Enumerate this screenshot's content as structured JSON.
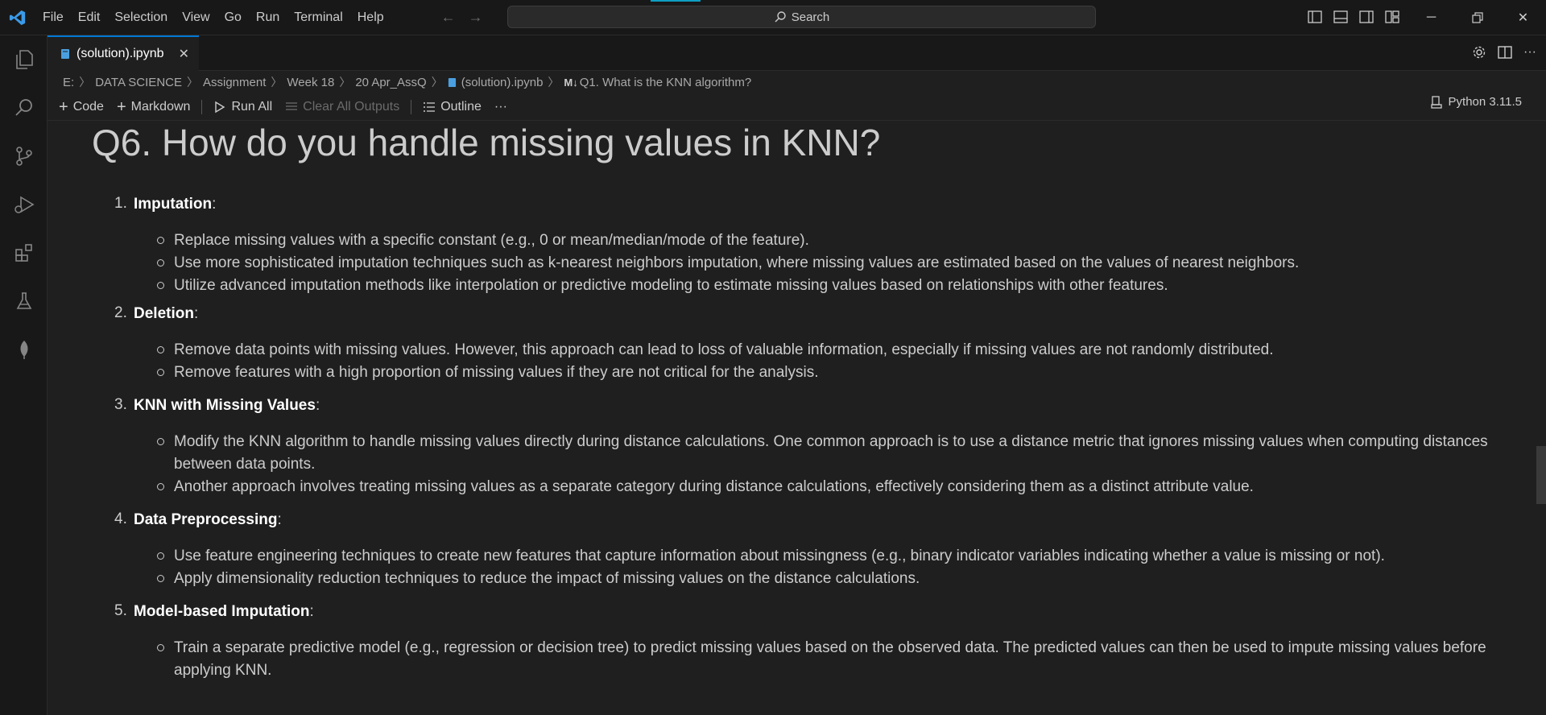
{
  "menu": [
    "File",
    "Edit",
    "Selection",
    "View",
    "Go",
    "Run",
    "Terminal",
    "Help"
  ],
  "search": {
    "label": "Search"
  },
  "tab": {
    "filename": "(solution).ipynb"
  },
  "breadcrumb": {
    "items": [
      "E:",
      "DATA SCIENCE",
      "Assignment",
      "Week 18",
      "20 Apr_AssQ",
      "(solution).ipynb"
    ],
    "last": "Q1. What is the KNN algorithm?",
    "md_badge": "M↓"
  },
  "toolbar": {
    "code": "Code",
    "markdown": "Markdown",
    "run_all": "Run All",
    "clear_all": "Clear All Outputs",
    "outline": "Outline",
    "more": "···",
    "kernel": "Python 3.11.5"
  },
  "notebook": {
    "heading": "Q6. How do you handle missing values in KNN?",
    "sections": [
      {
        "num": "1.",
        "title": "Imputation",
        "bullets": [
          "Replace missing values with a specific constant (e.g., 0 or mean/median/mode of the feature).",
          "Use more sophisticated imputation techniques such as k-nearest neighbors imputation, where missing values are estimated based on the values of nearest neighbors.",
          "Utilize advanced imputation methods like interpolation or predictive modeling to estimate missing values based on relationships with other features."
        ]
      },
      {
        "num": "2.",
        "title": "Deletion",
        "bullets": [
          "Remove data points with missing values. However, this approach can lead to loss of valuable information, especially if missing values are not randomly distributed.",
          "Remove features with a high proportion of missing values if they are not critical for the analysis."
        ]
      },
      {
        "num": "3.",
        "title": "KNN with Missing Values",
        "bullets": [
          "Modify the KNN algorithm to handle missing values directly during distance calculations. One common approach is to use a distance metric that ignores missing values when computing distances between data points.",
          "Another approach involves treating missing values as a separate category during distance calculations, effectively considering them as a distinct attribute value."
        ]
      },
      {
        "num": "4.",
        "title": "Data Preprocessing",
        "bullets": [
          "Use feature engineering techniques to create new features that capture information about missingness (e.g., binary indicator variables indicating whether a value is missing or not).",
          "Apply dimensionality reduction techniques to reduce the impact of missing values on the distance calculations."
        ]
      },
      {
        "num": "5.",
        "title": "Model-based Imputation",
        "bullets": [
          "Train a separate predictive model (e.g., regression or decision tree) to predict missing values based on the observed data. The predicted values can then be used to impute missing values before applying KNN."
        ]
      }
    ]
  },
  "colors": {
    "accent": "#0078d4",
    "background": "#1f1f1f",
    "chrome": "#181818"
  }
}
